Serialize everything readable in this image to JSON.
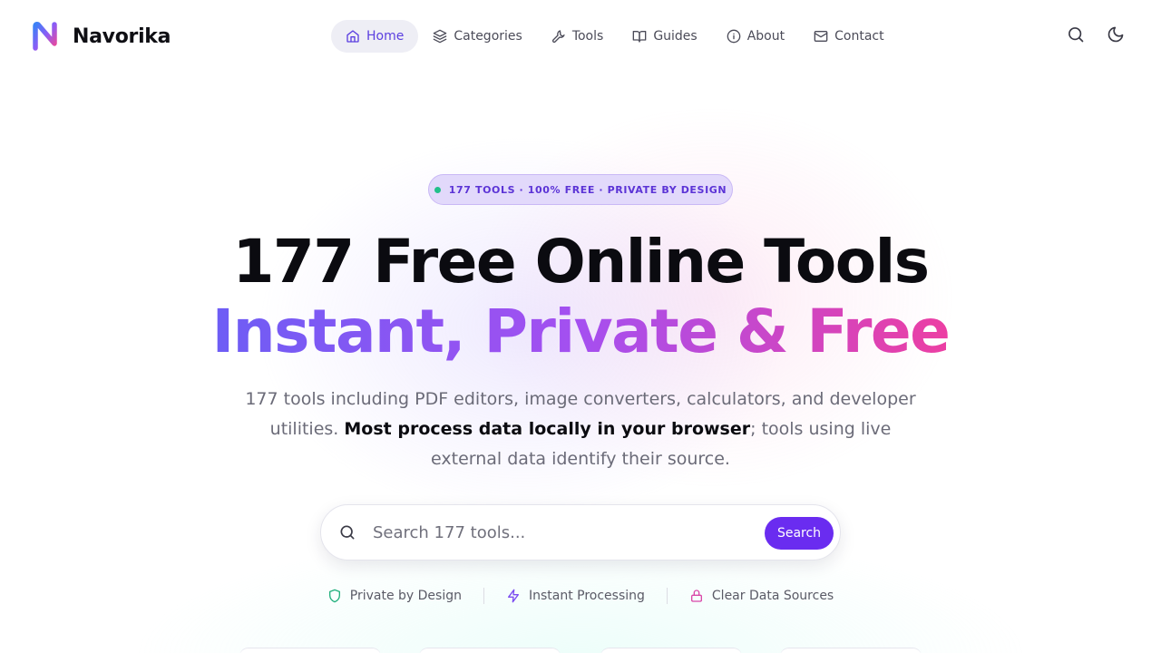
{
  "brand": {
    "name": "Navorika"
  },
  "nav": [
    {
      "label": "Home",
      "icon": "home-icon",
      "active": true
    },
    {
      "label": "Categories",
      "icon": "layers-icon",
      "active": false
    },
    {
      "label": "Tools",
      "icon": "wrench-icon",
      "active": false
    },
    {
      "label": "Guides",
      "icon": "book-icon",
      "active": false
    },
    {
      "label": "About",
      "icon": "info-icon",
      "active": false
    },
    {
      "label": "Contact",
      "icon": "mail-icon",
      "active": false
    }
  ],
  "header_actions": [
    "search-icon",
    "moon-icon"
  ],
  "hero": {
    "badge": "177 TOOLS · 100% FREE · PRIVATE BY DESIGN",
    "title_line1": "177 Free Online Tools",
    "title_line2": "Instant, Private & Free",
    "subtitle_part1": "177 tools including PDF editors, image converters, calculators, and developer utilities. ",
    "subtitle_bold": "Most process data locally in your browser",
    "subtitle_part2": "; tools using live external data identify their source."
  },
  "search": {
    "placeholder": "Search 177 tools...",
    "value": "",
    "button_label": "Search"
  },
  "features": [
    {
      "label": "Private by Design",
      "icon": "shield-icon"
    },
    {
      "label": "Instant Processing",
      "icon": "zap-icon"
    },
    {
      "label": "Clear Data Sources",
      "icon": "lock-icon"
    }
  ],
  "colors": {
    "accent": "#6a2cf0",
    "nav_active_text": "#5b3fe0",
    "gradient_start": "#6d5df5",
    "gradient_mid": "#a54ff0",
    "gradient_end": "#ec3fa3",
    "badge_dot": "#22c08a"
  }
}
